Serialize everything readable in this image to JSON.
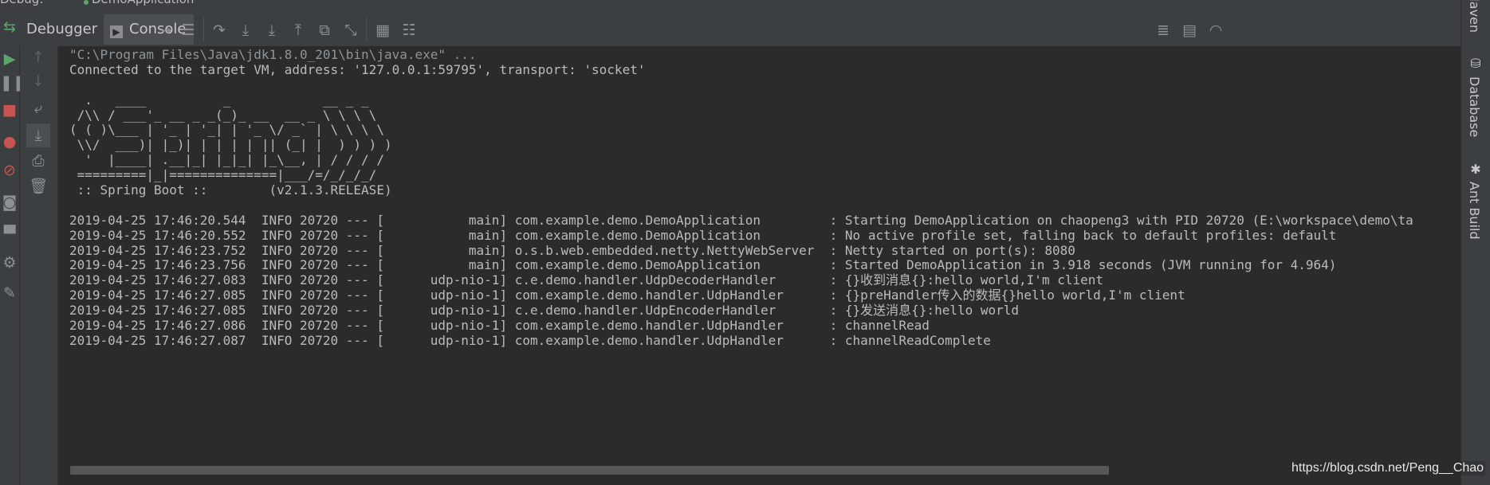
{
  "top_strip": {
    "debug_tab": "Debug:",
    "run_config": "DemoApplication"
  },
  "toolbar": {
    "debugger_tab": "Debugger",
    "console_tab": "Console",
    "icons": [
      "console-settings-icon",
      "menu-icon",
      "step-over-icon",
      "step-into-icon",
      "force-step-into-icon",
      "step-out-icon",
      "drop-frame-icon",
      "run-to-cursor-icon",
      "evaluate-icon",
      "trace-icon"
    ],
    "right_icons": [
      "align-icon",
      "memory-icon",
      "performance-icon"
    ]
  },
  "left_toolbar_icons": [
    "rerun-icon",
    "resume-icon",
    "pause-icon",
    "stop-icon",
    "view-breakpoints-icon",
    "mute-breakpoints-icon",
    "camera-icon",
    "layout-icon",
    "settings-icon",
    "pin-icon"
  ],
  "console_toolbar_icons": [
    "up-icon",
    "down-icon",
    "soft-wrap-icon",
    "scroll-to-end-icon",
    "print-icon",
    "clear-icon"
  ],
  "right_sidebar": {
    "maven": "Maven",
    "database": "Database",
    "ant_build": "Ant Build"
  },
  "console": {
    "lines": [
      "\"C:\\Program Files\\Java\\jdk1.8.0_201\\bin\\java.exe\" ...",
      "Connected to the target VM, address: '127.0.0.1:59795', transport: 'socket'",
      "",
      "  .   ____          _            __ _ _",
      " /\\\\ / ___'_ __ _ _(_)_ __  __ _ \\ \\ \\ \\",
      "( ( )\\___ | '_ | '_| | '_ \\/ _` | \\ \\ \\ \\",
      " \\\\/  ___)| |_)| | | | | || (_| |  ) ) ) )",
      "  '  |____| .__|_| |_|_| |_\\__, | / / / /",
      " =========|_|==============|___/=/_/_/_/",
      " :: Spring Boot ::        (v2.1.3.RELEASE)",
      "",
      "2019-04-25 17:46:20.544  INFO 20720 --- [           main] com.example.demo.DemoApplication         : Starting DemoApplication on chaopeng3 with PID 20720 (E:\\workspace\\demo\\ta",
      "2019-04-25 17:46:20.552  INFO 20720 --- [           main] com.example.demo.DemoApplication         : No active profile set, falling back to default profiles: default",
      "2019-04-25 17:46:23.752  INFO 20720 --- [           main] o.s.b.web.embedded.netty.NettyWebServer  : Netty started on port(s): 8080",
      "2019-04-25 17:46:23.756  INFO 20720 --- [           main] com.example.demo.DemoApplication         : Started DemoApplication in 3.918 seconds (JVM running for 4.964)",
      "2019-04-25 17:46:27.083  INFO 20720 --- [      udp-nio-1] c.e.demo.handler.UdpDecoderHandler       : {}收到消息{}:hello world,I'm client",
      "2019-04-25 17:46:27.085  INFO 20720 --- [      udp-nio-1] com.example.demo.handler.UdpHandler      : {}preHandler传入的数据{}hello world,I'm client",
      "2019-04-25 17:46:27.085  INFO 20720 --- [      udp-nio-1] c.e.demo.handler.UdpEncoderHandler       : {}发送消息{}:hello world",
      "2019-04-25 17:46:27.086  INFO 20720 --- [      udp-nio-1] com.example.demo.handler.UdpHandler      : channelRead",
      "2019-04-25 17:46:27.087  INFO 20720 --- [      udp-nio-1] com.example.demo.handler.UdpHandler      : channelReadComplete"
    ]
  },
  "watermark": "https://blog.csdn.net/Peng__Chao"
}
